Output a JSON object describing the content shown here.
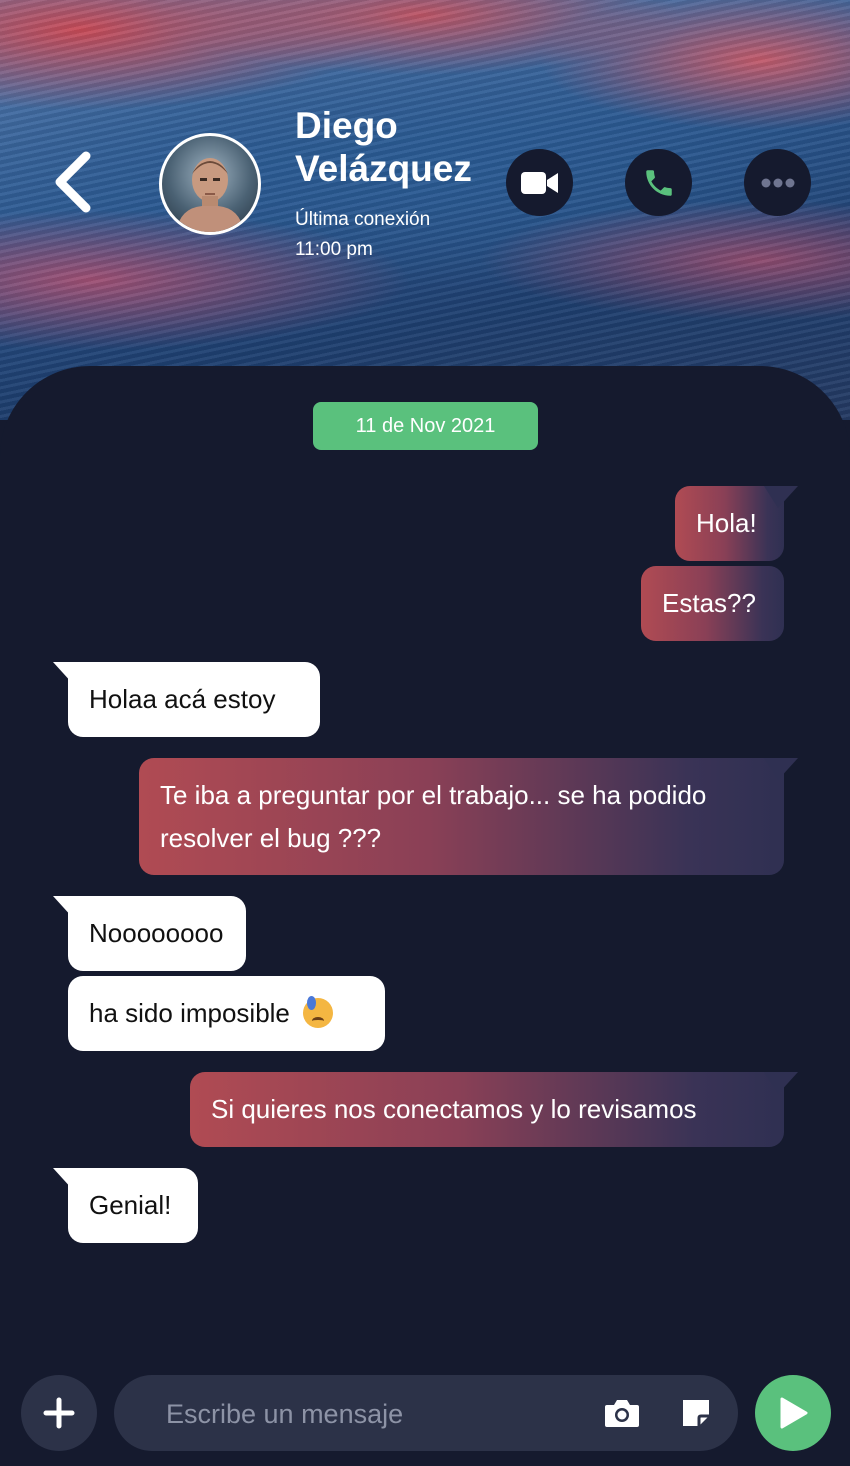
{
  "header": {
    "contact_name": "Diego Velázquez",
    "last_seen_label": "Última conexión",
    "last_seen_time": "11:00 pm"
  },
  "date_separator": "11 de Nov 2021",
  "messages": [
    {
      "from": "me",
      "text": "Hola!"
    },
    {
      "from": "me",
      "text": "Estas??"
    },
    {
      "from": "contact",
      "text": "Holaa acá estoy"
    },
    {
      "from": "me",
      "text": "Te iba a preguntar por el trabajo... se ha podido resolver el bug ???"
    },
    {
      "from": "contact",
      "text": "Noooooooo"
    },
    {
      "from": "contact",
      "text": "ha sido imposible",
      "emoji": "downcast-face-with-sweat"
    },
    {
      "from": "me",
      "text": "Si quieres nos conectamos y lo revisamos"
    },
    {
      "from": "contact",
      "text": "Genial!"
    }
  ],
  "composer": {
    "placeholder": "Escribe un mensaje"
  },
  "colors": {
    "background": "#151a2e",
    "accent_green": "#5ac17d",
    "outgoing_start": "#b04b53",
    "outgoing_end": "#2f3052",
    "incoming": "#ffffff",
    "input_bg": "#2c3248"
  },
  "icons": [
    "back-chevron-icon",
    "video-camera-icon",
    "phone-icon",
    "more-dots-icon",
    "plus-icon",
    "camera-icon",
    "sticker-icon",
    "send-icon"
  ]
}
